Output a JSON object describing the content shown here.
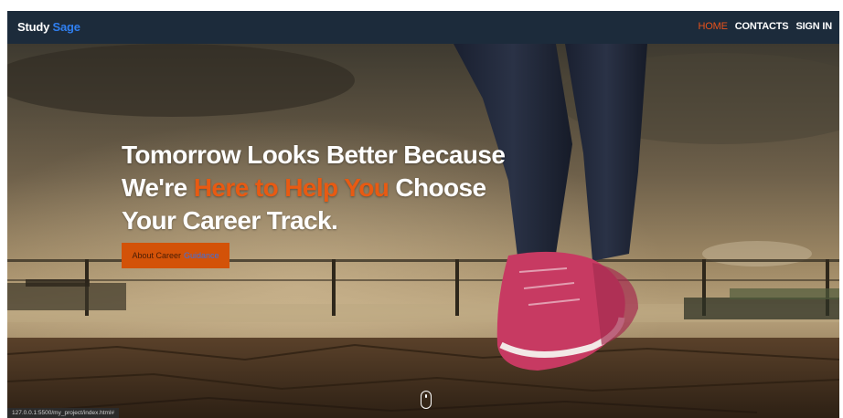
{
  "navbar": {
    "brand_first": "Study",
    "brand_second": "Sage",
    "links": [
      "HOME",
      "CONTACTS",
      "SIGN IN"
    ],
    "active": "HOME"
  },
  "hero": {
    "headline_part1": "Tomorrow Looks Better Because We're ",
    "headline_highlight": "Here to Help You",
    "headline_part2": " Choose Your Career Track.",
    "button_text_a": "About Career",
    "button_text_b": "Guidance"
  },
  "status_bar": {
    "url": "127.0.0.1:5500/my_project/index.html#"
  },
  "colors": {
    "navbar_bg": "#1c2b3b",
    "accent_orange": "#e85a12",
    "brand_blue": "#2f7ff0"
  }
}
